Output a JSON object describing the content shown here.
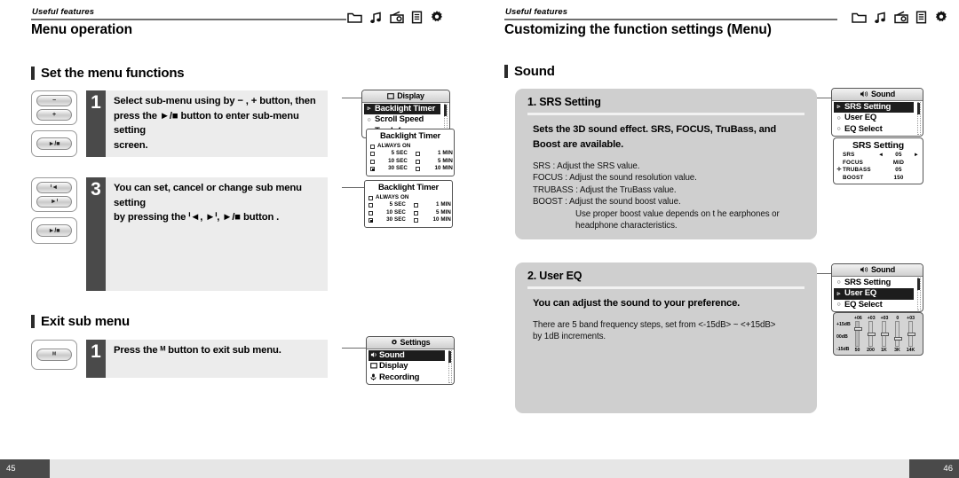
{
  "left_page": {
    "header": {
      "kicker": "Useful features",
      "title": "Menu operation",
      "icons": [
        "folder-icon",
        "music-note-icon",
        "radio-icon",
        "text-viewer-icon",
        "settings-gear-icon"
      ]
    },
    "section1": {
      "heading": "Set the menu functions"
    },
    "steps": [
      {
        "number": "1",
        "text_line1": "Select sub-menu using by − , + button, then",
        "text_line2": "press  the  ►/■ button to enter sub-menu setting",
        "text_line3": "screen.",
        "keys": [
          [
            "−",
            "+"
          ],
          [
            "►/■"
          ]
        ]
      },
      {
        "number": "3",
        "text_line1": "You can set, cancel or change sub menu setting",
        "text_line2": "by pressing the ᑊ◄, ►ᑊ, ►/■ button .",
        "keys": [
          [
            "ᑊ◄",
            "►ᑊ"
          ],
          [
            "►/■"
          ]
        ]
      }
    ],
    "display_lcd": {
      "title": "Display",
      "title_icon": "display-icon",
      "rows": [
        {
          "label": "Backlight Timer",
          "bullet": "▹",
          "selected": true
        },
        {
          "label": "Scroll Speed",
          "bullet": "○",
          "selected": false
        },
        {
          "label": "Tag Info",
          "bullet": "○",
          "selected": false
        }
      ]
    },
    "backlight_popups": [
      {
        "title": "Backlight Timer",
        "options": [
          {
            "label": "ALWAYS ON",
            "checked": false,
            "col": 1
          },
          {
            "label": "5 SEC",
            "checked": false,
            "col": 1
          },
          {
            "label": "1 MIN",
            "checked": false,
            "col": 2
          },
          {
            "label": "10 SEC",
            "checked": false,
            "col": 1
          },
          {
            "label": "5 MIN",
            "checked": false,
            "col": 2
          },
          {
            "label": "30 SEC",
            "checked": true,
            "col": 1
          },
          {
            "label": "10 MIN",
            "checked": false,
            "col": 2
          }
        ]
      },
      {
        "title": "Backlight Timer",
        "options": [
          {
            "label": "ALWAYS ON",
            "checked": false,
            "col": 1
          },
          {
            "label": "5 SEC",
            "checked": false,
            "col": 1
          },
          {
            "label": "1 MIN",
            "checked": false,
            "col": 2
          },
          {
            "label": "10 SEC",
            "checked": false,
            "col": 1
          },
          {
            "label": "5 MIN",
            "checked": false,
            "col": 2
          },
          {
            "label": "30 SEC",
            "checked": true,
            "col": 1
          },
          {
            "label": "10 MIN",
            "checked": false,
            "col": 2
          }
        ]
      }
    ],
    "section2": {
      "heading": "Exit sub menu"
    },
    "exit_step": {
      "number": "1",
      "text": "Press the ᴹ button to exit sub menu.",
      "key": "ᴹ"
    },
    "settings_lcd": {
      "title": "Settings",
      "title_icon": "settings-gear-icon",
      "rows": [
        {
          "label": "Sound",
          "icon": "speaker-icon",
          "selected": true
        },
        {
          "label": "Display",
          "icon": "display-icon",
          "selected": false
        },
        {
          "label": "Recording",
          "icon": "microphone-icon",
          "selected": false
        }
      ]
    },
    "page_number": "45"
  },
  "right_page": {
    "header": {
      "kicker": "Useful features",
      "title": "Customizing the function settings (Menu)",
      "icons": [
        "folder-icon",
        "music-note-icon",
        "radio-icon",
        "text-viewer-icon",
        "settings-gear-icon"
      ]
    },
    "section": {
      "heading": "Sound"
    },
    "cards": [
      {
        "title": "1. SRS Setting",
        "lead_line1": "Sets the 3D sound effect. SRS, FOCUS,  TruBass, and",
        "lead_line2": "Boost are available.",
        "body": [
          "SRS : Adjust the SRS value.",
          "FOCUS : Adjust the sound resolution value.",
          "TRUBASS : Adjust the TruBass value.",
          "BOOST : Adjust the sound boost value."
        ],
        "body_indent": [
          "Use proper boost value depends on t he earphones or",
          "headphone characteristics."
        ]
      },
      {
        "title": "2. User EQ",
        "lead_line1": "You can adjust the sound to your preference.",
        "body": [
          "There are 5 band frequency steps, set from <-15dB> ~ <+15dB>",
          "by 1dB increments."
        ]
      }
    ],
    "sound_lcd_1": {
      "title": "Sound",
      "title_icon": "speaker-icon",
      "rows": [
        {
          "label": "SRS Setting",
          "bullet": "▹",
          "selected": true
        },
        {
          "label": "User EQ",
          "bullet": "○",
          "selected": false
        },
        {
          "label": "EQ Select",
          "bullet": "○",
          "selected": false
        }
      ]
    },
    "srs_lcd": {
      "title": "SRS Setting",
      "rows": [
        {
          "name": "SRS",
          "value": "05",
          "caret": false,
          "arrows": true
        },
        {
          "name": "FOCUS",
          "value": "MID",
          "caret": false,
          "arrows": false
        },
        {
          "name": "TRUBASS",
          "value": "05",
          "caret": true,
          "arrows": false
        },
        {
          "name": "BOOST",
          "value": "150",
          "caret": false,
          "arrows": false
        }
      ],
      "arrow_left": "◄",
      "arrow_right": "►"
    },
    "sound_lcd_2": {
      "title": "Sound",
      "title_icon": "speaker-icon",
      "rows": [
        {
          "label": "SRS Setting",
          "bullet": "○",
          "selected": false
        },
        {
          "label": "User EQ",
          "bullet": "▹",
          "selected": true
        },
        {
          "label": "EQ Select",
          "bullet": "○",
          "selected": false
        }
      ]
    },
    "eq_lcd": {
      "axis_top": "+15dB",
      "axis_mid": "00dB",
      "axis_bottom": "-15dB",
      "bands": [
        {
          "freq": "50",
          "value": "+06",
          "pos": 22
        },
        {
          "freq": "200",
          "value": "+03",
          "pos": 45
        },
        {
          "freq": "1K",
          "value": "+03",
          "pos": 45
        },
        {
          "freq": "3K",
          "value": "0",
          "pos": 62
        },
        {
          "freq": "14K",
          "value": "+03",
          "pos": 45
        }
      ]
    },
    "page_number": "46"
  }
}
